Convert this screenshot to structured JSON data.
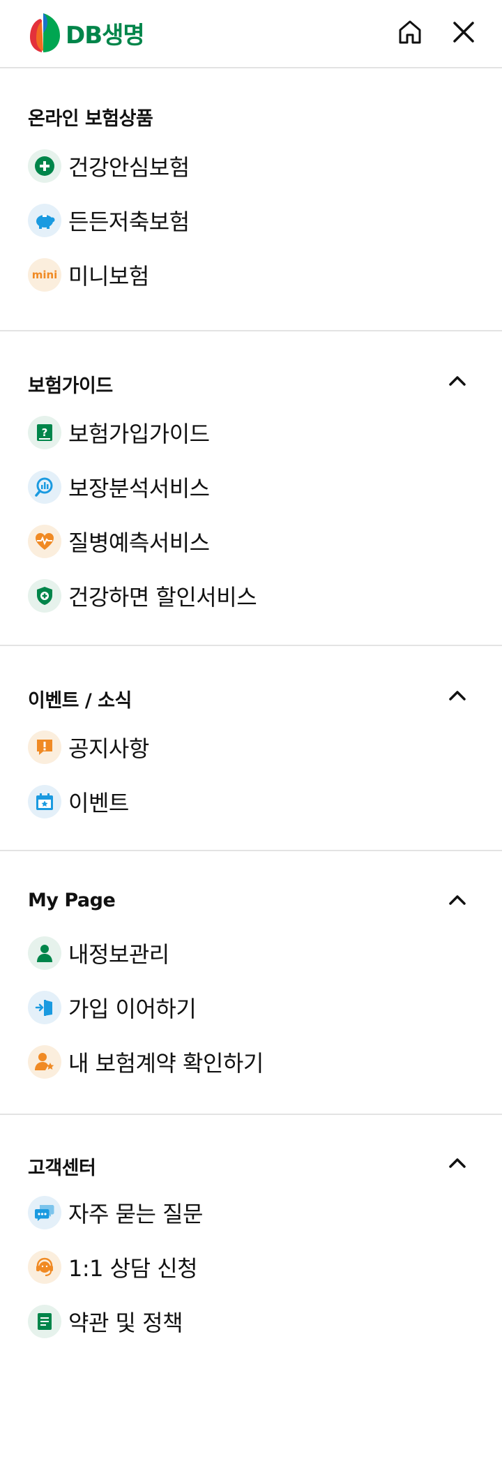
{
  "header": {
    "brand": "DB생명",
    "brand_colors": {
      "blue": "#1a73c9",
      "orange": "#f26b21",
      "red": "#e3313b",
      "green": "#00854a"
    },
    "home_icon": "home-icon",
    "close_icon": "close-icon"
  },
  "sections": {
    "online": {
      "title": "온라인 보험상품",
      "items": [
        {
          "label": "건강안심보험",
          "icon": "plus-circle-icon"
        },
        {
          "label": "든든저축보험",
          "icon": "piggy-bank-icon"
        },
        {
          "label": "미니보험",
          "icon": "mini-badge-icon",
          "icon_text": "mini"
        }
      ]
    },
    "guide": {
      "title": "보험가이드",
      "items": [
        {
          "label": "보험가입가이드",
          "icon": "question-book-icon"
        },
        {
          "label": "보장분석서비스",
          "icon": "chart-magnifier-icon"
        },
        {
          "label": "질병예측서비스",
          "icon": "heart-pulse-icon"
        },
        {
          "label": "건강하면 할인서비스",
          "icon": "shield-plus-icon"
        }
      ]
    },
    "events": {
      "title": "이벤트 / 소식",
      "items": [
        {
          "label": "공지사항",
          "icon": "notice-icon"
        },
        {
          "label": "이벤트",
          "icon": "calendar-star-icon"
        }
      ]
    },
    "mypage": {
      "title": "My Page",
      "items": [
        {
          "label": "내정보관리",
          "icon": "person-icon"
        },
        {
          "label": "가입 이어하기",
          "icon": "door-enter-icon"
        },
        {
          "label": "내 보험계약 확인하기",
          "icon": "person-star-icon"
        }
      ]
    },
    "support": {
      "title": "고객센터",
      "items": [
        {
          "label": "자주 묻는 질문",
          "icon": "chat-bubbles-icon"
        },
        {
          "label": "1:1 상담 신청",
          "icon": "headset-agent-icon"
        },
        {
          "label": "약관 및 정책",
          "icon": "document-icon"
        }
      ]
    }
  }
}
